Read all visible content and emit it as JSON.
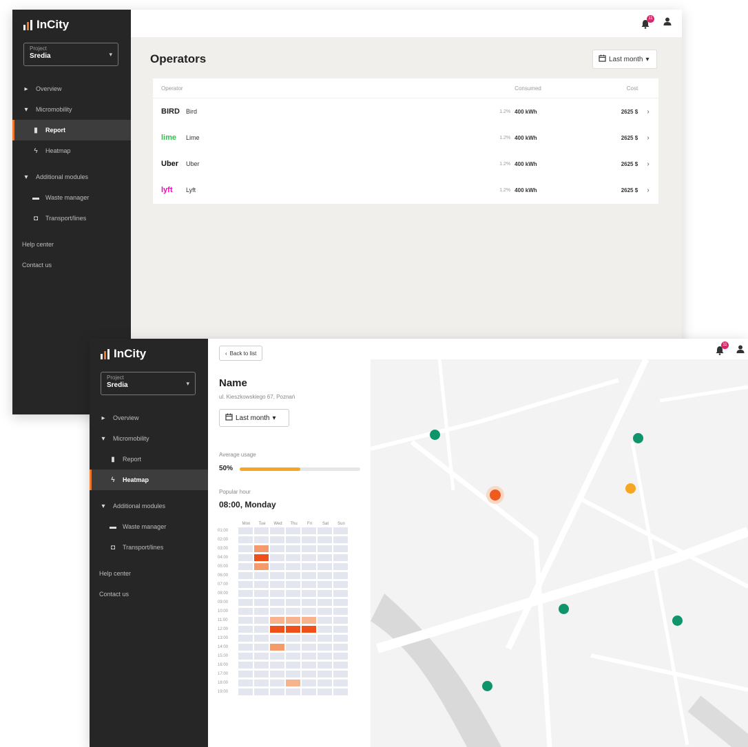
{
  "app": {
    "name": "InCity"
  },
  "project": {
    "label": "Project",
    "value": "Sredia"
  },
  "notifications": {
    "count": "11"
  },
  "sidebar": {
    "overview": "Overview",
    "micromobility": "Micromobility",
    "report": "Report",
    "heatmap": "Heatmap",
    "additional": "Additional modules",
    "waste": "Waste manager",
    "transport": "Transport/lines",
    "help": "Help center",
    "contact": "Contact us"
  },
  "report": {
    "title": "Operators",
    "date_range": "Last month",
    "columns": {
      "operator": "Operator",
      "consumed": "Consumed",
      "cost": "Cost"
    },
    "rows": [
      {
        "logo": "BIRD",
        "name": "Bird",
        "pct": "1.2%",
        "consumed": "400 kWh",
        "cost": "2625 $"
      },
      {
        "logo": "lime",
        "name": "Lime",
        "pct": "1.2%",
        "consumed": "400 kWh",
        "cost": "2625 $"
      },
      {
        "logo": "Uber",
        "name": "Uber",
        "pct": "1.2%",
        "consumed": "400 kWh",
        "cost": "2625 $"
      },
      {
        "logo": "lyft",
        "name": "Lyft",
        "pct": "1.2%",
        "consumed": "400 kWh",
        "cost": "2625 $"
      }
    ],
    "logo_colors": {
      "bird": "#222222",
      "lime": "#2fbf4f",
      "uber": "#111111",
      "lyft": "#ff00bf"
    }
  },
  "detail": {
    "back_label": "Back to list",
    "name": "Name",
    "address": "ul. Kieszkowskiego 67, Poznań",
    "date_range": "Last month",
    "avg_usage_label": "Average usage",
    "avg_usage_value": "50%",
    "avg_usage_fraction": 0.5,
    "popular_label": "Popular hour",
    "popular_value": "08:00, Monday"
  },
  "heatmap": {
    "days": [
      "Mon",
      "Tue",
      "Wed",
      "Thu",
      "Fri",
      "Sat",
      "Sun"
    ],
    "hours": [
      "01:00",
      "02:00",
      "03:00",
      "04:00",
      "05:00",
      "06:00",
      "07:00",
      "08:00",
      "09:00",
      "10:00",
      "11:00",
      "12:00",
      "13:00",
      "14:00",
      "15:00",
      "16:00",
      "17:00",
      "18:00",
      "19:00"
    ],
    "levels": [
      [
        0,
        0,
        0,
        0,
        0,
        0,
        0
      ],
      [
        0,
        0,
        0,
        0,
        0,
        0,
        0
      ],
      [
        0,
        2,
        0,
        0,
        0,
        0,
        0
      ],
      [
        0,
        3,
        0,
        0,
        0,
        0,
        0
      ],
      [
        0,
        2,
        0,
        0,
        0,
        0,
        0
      ],
      [
        0,
        0,
        0,
        0,
        0,
        0,
        0
      ],
      [
        0,
        0,
        0,
        0,
        0,
        0,
        0
      ],
      [
        0,
        0,
        0,
        0,
        0,
        0,
        0
      ],
      [
        0,
        0,
        0,
        0,
        0,
        0,
        0
      ],
      [
        0,
        0,
        0,
        0,
        0,
        0,
        0
      ],
      [
        0,
        0,
        1,
        1,
        1,
        0,
        0
      ],
      [
        0,
        0,
        3,
        3,
        3,
        0,
        0
      ],
      [
        0,
        0,
        0,
        0,
        0,
        0,
        0
      ],
      [
        0,
        0,
        2,
        0,
        0,
        0,
        0
      ],
      [
        0,
        0,
        0,
        0,
        0,
        0,
        0
      ],
      [
        0,
        0,
        0,
        0,
        0,
        0,
        0
      ],
      [
        0,
        0,
        0,
        0,
        0,
        0,
        0
      ],
      [
        0,
        0,
        0,
        1,
        0,
        0,
        0
      ],
      [
        0,
        0,
        0,
        0,
        0,
        0,
        0
      ]
    ],
    "colors": [
      "#e3e6ee",
      "#f7b38d",
      "#f59a6b",
      "#ef4f1a"
    ]
  },
  "map": {
    "colors": {
      "green": "#10946b",
      "yellow": "#f5a623",
      "red": "#ef5a1f"
    }
  }
}
